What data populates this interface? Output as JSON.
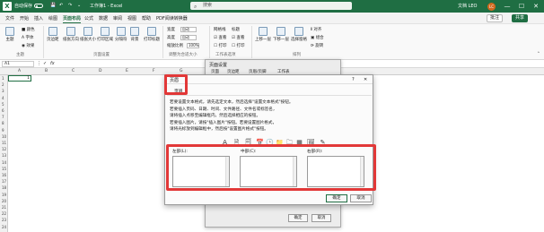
{
  "titlebar": {
    "autosave": "自动保存",
    "doc_title": "工作簿1 - Excel",
    "search_placeholder": "搜索",
    "user_name": "文档 LEO",
    "avatar": "LC",
    "min": "—",
    "max": "☐",
    "close": "✕",
    "colors": {
      "bar": "#1f6e43"
    }
  },
  "menu": {
    "items": [
      "文件",
      "开始",
      "插入",
      "绘图",
      "页面布局",
      "公式",
      "数据",
      "审阅",
      "视图",
      "帮助",
      "PDF阅读转换器"
    ],
    "active": "页面布局",
    "comment_btn": "批注",
    "share_btn": "共享"
  },
  "ribbon": {
    "theme_group": {
      "theme": "主题",
      "colors": "颜色",
      "fonts": "字体",
      "effects": "效果",
      "label": "主题"
    },
    "page_setup": {
      "margins": "页边距",
      "orientation": "纸张方向",
      "size": "纸张大小",
      "print_area": "打印区域",
      "breaks": "分隔符",
      "background": "背景",
      "print_titles": "打印标题",
      "label": "页面设置"
    },
    "scale": {
      "width": "宽度",
      "width_val": "自动",
      "height": "高度",
      "height_val": "自动",
      "scale": "缩放比例",
      "scale_val": "100%",
      "label": "调整为合适大小"
    },
    "sheet_options": {
      "gridlines": "网格线",
      "headings": "标题",
      "view1": "查看",
      "print1": "打印",
      "view2": "查看",
      "print2": "打印",
      "label": "工作表选项"
    },
    "arrange": {
      "forward": "上移一层",
      "backward": "下移一层",
      "pane": "选择窗格",
      "align": "对齐",
      "group": "组合",
      "rotate": "旋转",
      "label": "排列"
    }
  },
  "formula": {
    "namebox": "A1",
    "fx": "fx"
  },
  "grid": {
    "cols": [
      "A",
      "B",
      "C",
      "D",
      "E",
      "F",
      "G",
      "H",
      "I"
    ],
    "rows": [
      "1",
      "2",
      "3",
      "4",
      "5",
      "6",
      "7",
      "8",
      "9",
      "10",
      "11",
      "12",
      "13",
      "14",
      "15",
      "16",
      "17",
      "18",
      "19",
      "20",
      "21",
      "22",
      "23",
      "24"
    ],
    "a1_value": "1"
  },
  "page_setup_dialog": {
    "title": "页面设置",
    "tabs": [
      "页面",
      "页边距",
      "页眉/页脚",
      "工作表"
    ],
    "ok": "确定",
    "cancel": "取消"
  },
  "header_dialog": {
    "title": "页眉",
    "help": "?",
    "close": "✕",
    "tab": "页眉",
    "instructions": [
      "若要设置文本格式，请先选定文本，然后选择\"设置文本格式\"按钮。",
      "若要插入页码、日期、时间、文件路径、文件名或标签名，",
      "    请将插入点移至编辑框内，然后选择相应的按钮。",
      "若要插入图片，请按\"插入图片\"按钮。若要设置图片格式，",
      "    请将光标放到编辑框中，然后按\"设置图片格式\"按钮。"
    ],
    "toolbar_icons": [
      "A",
      "🗎",
      "🗐",
      "📅",
      "🕒",
      "📁",
      "🗀",
      "▦",
      "🖼",
      "✎"
    ],
    "sections": {
      "left": "左部(L):",
      "center": "中部(C):",
      "right": "右部(R):"
    },
    "ok": "确定",
    "cancel": "取消"
  }
}
